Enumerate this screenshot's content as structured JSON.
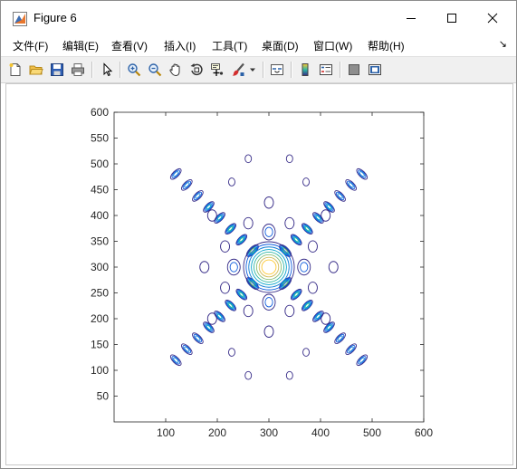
{
  "window": {
    "title": "Figure 6",
    "icon": "matlab-figure-icon",
    "controls": [
      "minimize-icon",
      "maximize-icon",
      "close-icon"
    ]
  },
  "menu": {
    "items": [
      "文件(F)",
      "编辑(E)",
      "查看(V)",
      "插入(I)",
      "工具(T)",
      "桌面(D)",
      "窗口(W)",
      "帮助(H)"
    ],
    "overflow_arrow": "↘"
  },
  "toolbar": {
    "icons": [
      "new-figure-icon",
      "open-file-icon",
      "save-icon",
      "print-icon",
      "select-arrow-icon",
      "zoom-in-icon",
      "zoom-out-icon",
      "pan-hand-icon",
      "rotate-3d-icon",
      "data-cursor-icon",
      "brush-icon",
      "brush-dropdown-icon",
      "link-plot-icon",
      "insert-colorbar-icon",
      "insert-legend-icon",
      "hide-plot-tools-icon",
      "show-plot-tools-icon"
    ]
  },
  "chart_data": {
    "type": "contour",
    "title": "",
    "xlabel": "",
    "ylabel": "",
    "xlim": [
      0,
      600
    ],
    "ylim": [
      0,
      600
    ],
    "xticks": [
      100,
      200,
      300,
      400,
      500,
      600
    ],
    "yticks": [
      50,
      100,
      150,
      200,
      250,
      300,
      350,
      400,
      450,
      500,
      550,
      600
    ],
    "grid": false,
    "colormap": "parula",
    "level_colors": [
      "#352a87",
      "#0f5cdd",
      "#1481d6",
      "#06a4ca",
      "#2eb7a4",
      "#87bf77",
      "#d1bb59",
      "#fec832"
    ],
    "pattern": "X-shaped diagonal chains of closed contour ellipses centered at (300, 300)",
    "diagonal_chain_centers": [
      -255,
      -225,
      -195,
      -165,
      -135,
      -105,
      -75,
      -45,
      0,
      45,
      75,
      105,
      135,
      165,
      195,
      225,
      255
    ],
    "central_peak": {
      "x": 300,
      "y": 300
    },
    "side_lobes": [
      {
        "x": 232,
        "y": 300
      },
      {
        "x": 368,
        "y": 300
      },
      {
        "x": 300,
        "y": 232
      },
      {
        "x": 300,
        "y": 368
      },
      {
        "x": 215,
        "y": 260
      },
      {
        "x": 385,
        "y": 260
      },
      {
        "x": 215,
        "y": 340
      },
      {
        "x": 385,
        "y": 340
      },
      {
        "x": 260,
        "y": 215
      },
      {
        "x": 340,
        "y": 215
      },
      {
        "x": 260,
        "y": 385
      },
      {
        "x": 340,
        "y": 385
      },
      {
        "x": 190,
        "y": 400
      },
      {
        "x": 410,
        "y": 400
      },
      {
        "x": 190,
        "y": 200
      },
      {
        "x": 410,
        "y": 200
      },
      {
        "x": 175,
        "y": 300
      },
      {
        "x": 425,
        "y": 300
      },
      {
        "x": 300,
        "y": 175
      },
      {
        "x": 300,
        "y": 425
      },
      {
        "x": 228,
        "y": 465
      },
      {
        "x": 372,
        "y": 465
      },
      {
        "x": 228,
        "y": 135
      },
      {
        "x": 372,
        "y": 135
      },
      {
        "x": 260,
        "y": 510
      },
      {
        "x": 340,
        "y": 510
      },
      {
        "x": 260,
        "y": 90
      },
      {
        "x": 340,
        "y": 90
      }
    ]
  }
}
